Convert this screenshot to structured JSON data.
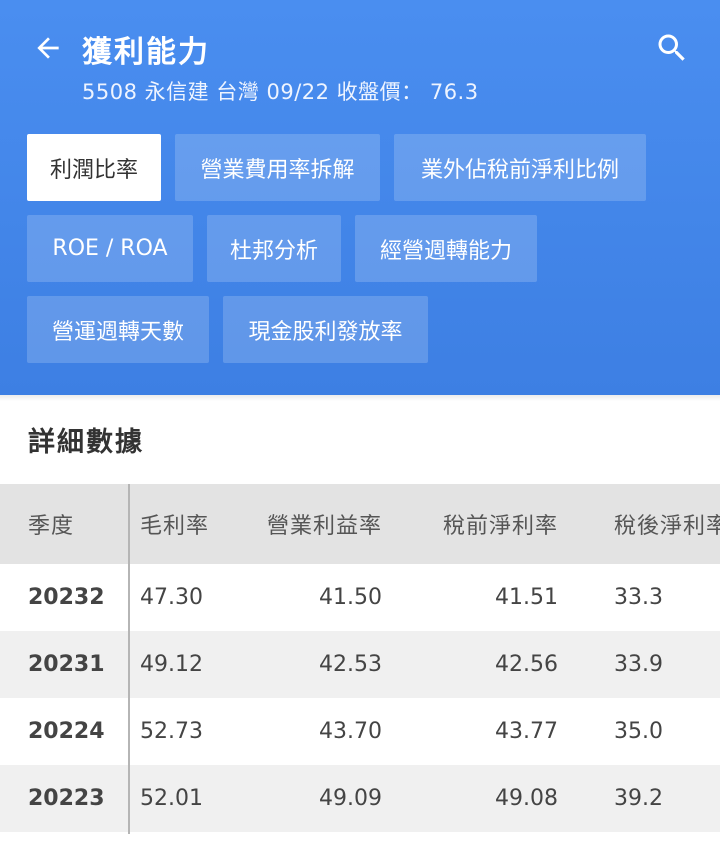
{
  "header": {
    "title": "獲利能力",
    "subtitle": "5508 永信建 台灣 09/22 收盤價： 76.3",
    "back_icon": "arrow-left-icon",
    "search_icon": "search-icon"
  },
  "tabs": [
    {
      "label": "利潤比率",
      "active": true
    },
    {
      "label": "營業費用率拆解",
      "active": false
    },
    {
      "label": "業外佔稅前淨利比例",
      "active": false
    },
    {
      "label": "ROE / ROA",
      "active": false
    },
    {
      "label": "杜邦分析",
      "active": false
    },
    {
      "label": "經營週轉能力",
      "active": false
    },
    {
      "label": "營運週轉天數",
      "active": false
    },
    {
      "label": "現金股利發放率",
      "active": false
    }
  ],
  "section": {
    "title": "詳細數據"
  },
  "table": {
    "headers": [
      "季度",
      "毛利率",
      "營業利益率",
      "稅前淨利率",
      "稅後淨利率"
    ],
    "rows": [
      [
        "20232",
        "47.30",
        "41.50",
        "41.51",
        "33.3"
      ],
      [
        "20231",
        "49.12",
        "42.53",
        "42.56",
        "33.9"
      ],
      [
        "20224",
        "52.73",
        "43.70",
        "43.77",
        "35.0"
      ],
      [
        "20223",
        "52.01",
        "49.09",
        "49.08",
        "39.2"
      ]
    ]
  },
  "colors": {
    "header_bg": "#4a8ef0",
    "table_head_bg": "#e3e3e3",
    "row_alt_bg": "#f0f0f0"
  }
}
